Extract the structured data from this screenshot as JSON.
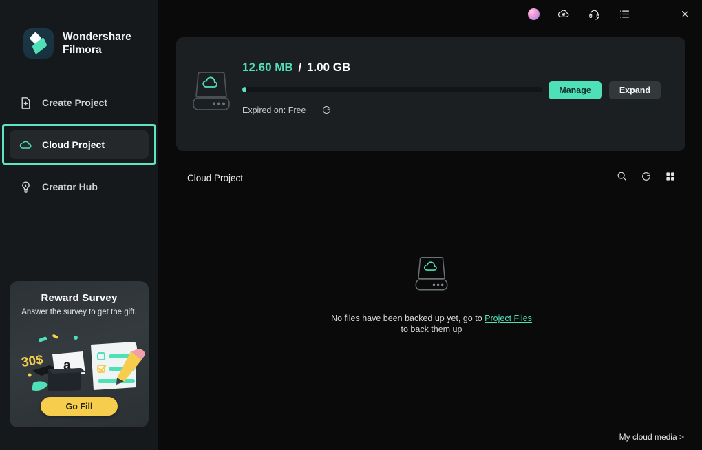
{
  "app": {
    "brand_line1": "Wondershare",
    "brand_line2": "Filmora"
  },
  "titlebar": {
    "avatar": "user-avatar",
    "cloud_transfer": "cloud-transfer-icon",
    "support": "headset-icon",
    "menu": "list-menu-icon",
    "minimize": "minimize-icon",
    "close": "close-icon"
  },
  "sidebar": {
    "items": [
      {
        "label": "Create Project",
        "icon": "file-plus-icon",
        "active": false
      },
      {
        "label": "Cloud Project",
        "icon": "cloud-icon",
        "active": true
      },
      {
        "label": "Creator Hub",
        "icon": "lightbulb-icon",
        "active": false
      }
    ],
    "promo": {
      "title": "Reward Survey",
      "subtitle": "Answer the survey to get the gift.",
      "amount": "30$",
      "button": "Go Fill"
    }
  },
  "storage": {
    "used": "12.60 MB",
    "separator": "/",
    "total": "1.00 GB",
    "percent": 1.2,
    "expired_label": "Expired on: Free",
    "refresh_icon": "refresh-icon",
    "drive_icon": "cloud-drive-icon",
    "manage_button": "Manage",
    "expand_button": "Expand"
  },
  "content": {
    "title": "Cloud Project",
    "tools": {
      "search": "search-icon",
      "refresh": "refresh-icon",
      "grid": "grid-view-icon"
    },
    "empty": {
      "icon": "cloud-drive-icon",
      "text_before": "No files have been backed up yet, go to ",
      "link": "Project Files",
      "text_after": "to back them up"
    }
  },
  "footer": {
    "cloud_media": "My cloud media >"
  },
  "colors": {
    "accent": "#4fe0b8",
    "accent_light": "#5fe3c0",
    "sidebar_bg": "#16191b",
    "main_bg": "#0a0a0a",
    "card_bg": "#1c1f21",
    "promo_button": "#f6cd4c"
  }
}
